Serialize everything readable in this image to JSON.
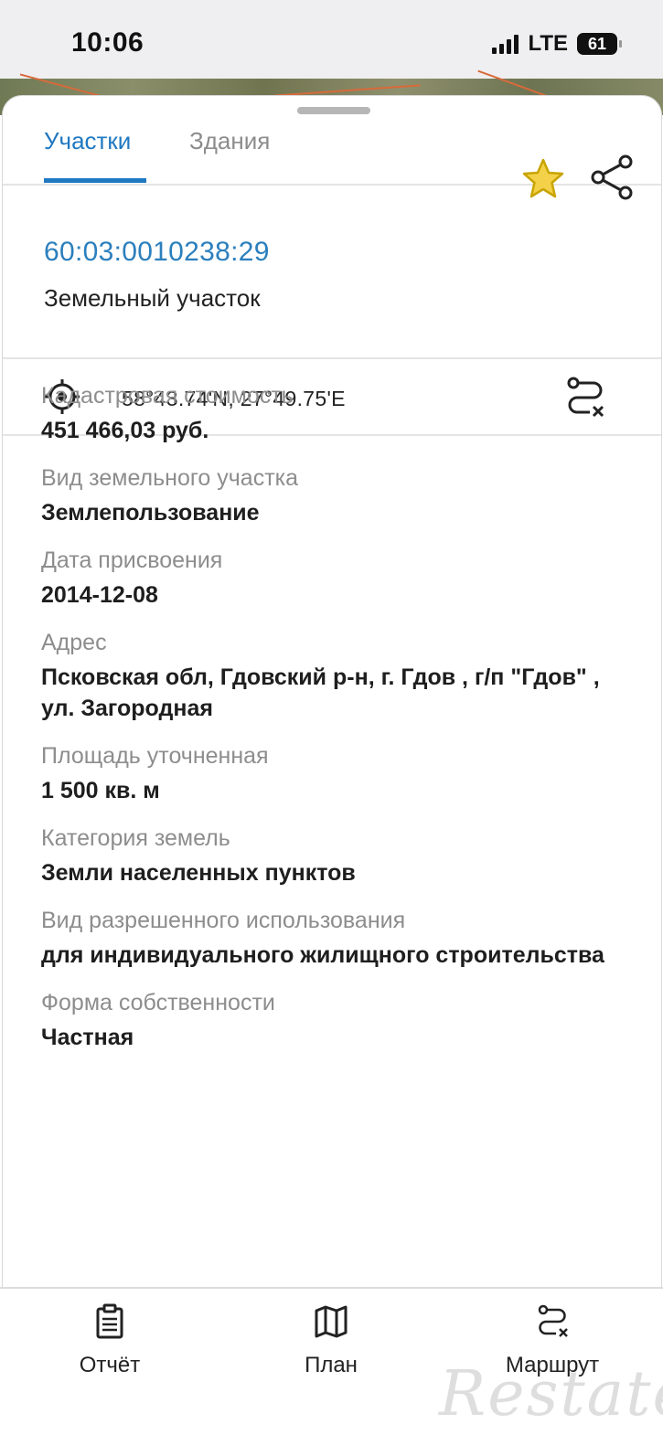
{
  "status_bar": {
    "time": "10:06",
    "network": "LTE",
    "battery": "61"
  },
  "tabs": [
    {
      "label": "Участки",
      "active": true
    },
    {
      "label": "Здания",
      "active": false
    }
  ],
  "parcel": {
    "cadastral_number": "60:03:0010238:29",
    "object_type": "Земельный участок"
  },
  "coordinates": "58°43.74'N, 27°49.75'E",
  "details": [
    {
      "label": "Кадастровая стоимость",
      "value": "451 466,03 руб."
    },
    {
      "label": "Вид земельного участка",
      "value": "Землепользование"
    },
    {
      "label": "Дата присвоения",
      "value": "2014-12-08"
    },
    {
      "label": "Адрес",
      "value": "Псковская обл, Гдовский р-н, г. Гдов , г/п \"Гдов\" , ул. Загородная"
    },
    {
      "label": "Площадь уточненная",
      "value": "1 500 кв. м"
    },
    {
      "label": "Категория земель",
      "value": "Земли населенных пунктов"
    },
    {
      "label": "Вид разрешенного использования",
      "value": "для индивидуального жилищного строительства"
    },
    {
      "label": "Форма собственности",
      "value": "Частная"
    }
  ],
  "bottom_nav": [
    {
      "label": "Отчёт",
      "icon": "report-icon"
    },
    {
      "label": "План",
      "icon": "map-icon"
    },
    {
      "label": "Маршрут",
      "icon": "route-icon"
    }
  ],
  "watermark": "Restate",
  "colors": {
    "accent": "#1f78c1",
    "star": "#e9c21b"
  }
}
